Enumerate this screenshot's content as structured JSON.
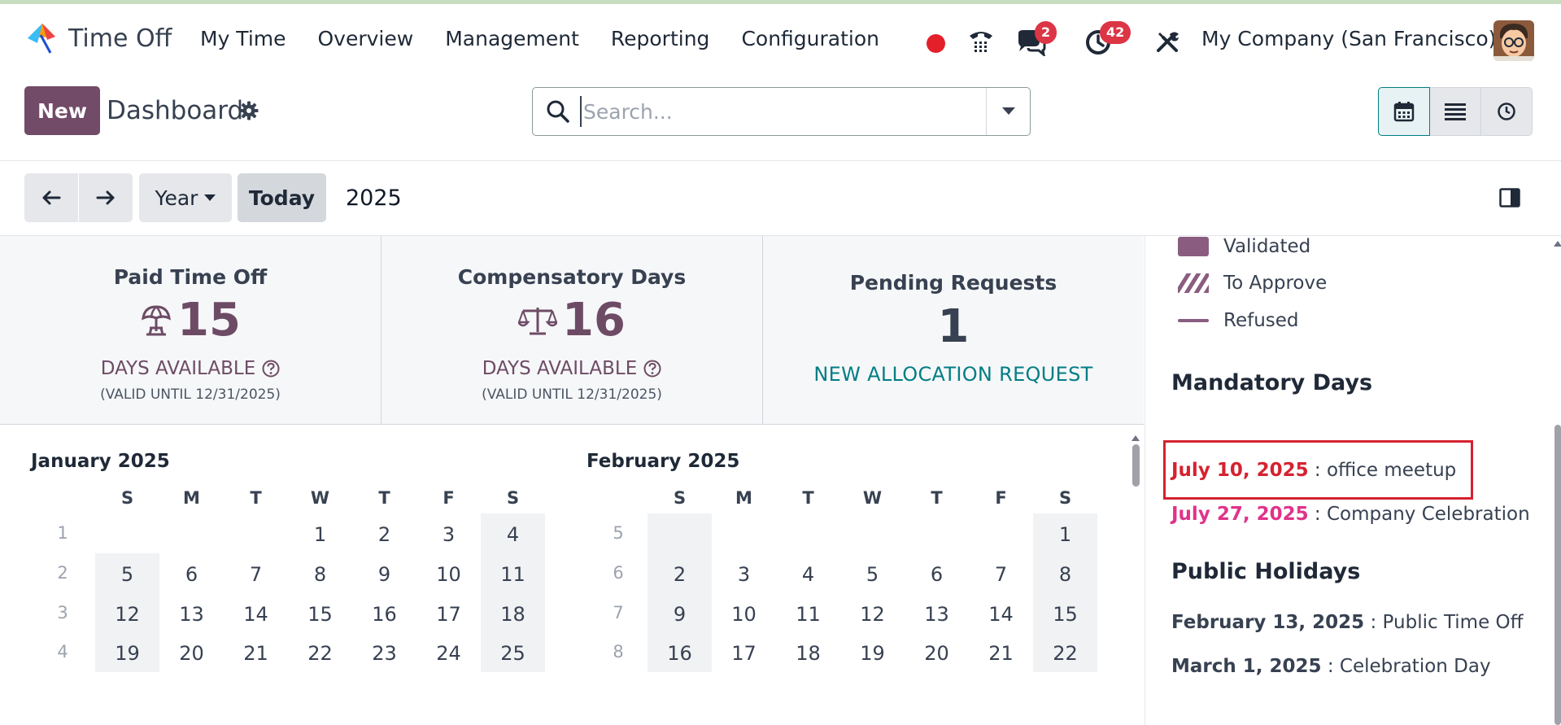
{
  "app": {
    "name": "Time Off"
  },
  "menu": [
    "My Time",
    "Overview",
    "Management",
    "Reporting",
    "Configuration"
  ],
  "systray": {
    "messages_badge": "2",
    "activities_badge": "42",
    "company": "My Company (San Francisco)"
  },
  "control_panel": {
    "new_label": "New",
    "title": "Dashboard",
    "search_placeholder": "Search..."
  },
  "toolbar": {
    "scale_label": "Year",
    "today_label": "Today",
    "current_period": "2025"
  },
  "stats": {
    "paid": {
      "title": "Paid Time Off",
      "value": "15",
      "sub": "DAYS AVAILABLE",
      "valid": "(VALID UNTIL 12/31/2025)"
    },
    "comp": {
      "title": "Compensatory Days",
      "value": "16",
      "sub": "DAYS AVAILABLE",
      "valid": "(VALID UNTIL 12/31/2025)"
    },
    "pending": {
      "title": "Pending Requests",
      "value": "1",
      "link": "NEW ALLOCATION REQUEST"
    }
  },
  "calendar": {
    "dow": [
      "S",
      "M",
      "T",
      "W",
      "T",
      "F",
      "S"
    ],
    "months": [
      {
        "title": "January 2025",
        "weeks": [
          {
            "wk": "1",
            "days": [
              "",
              "",
              "",
              "1",
              "2",
              "3",
              "4"
            ]
          },
          {
            "wk": "2",
            "days": [
              "5",
              "6",
              "7",
              "8",
              "9",
              "10",
              "11"
            ]
          },
          {
            "wk": "3",
            "days": [
              "12",
              "13",
              "14",
              "15",
              "16",
              "17",
              "18"
            ]
          },
          {
            "wk": "4",
            "days": [
              "19",
              "20",
              "21",
              "22",
              "23",
              "24",
              "25"
            ]
          }
        ]
      },
      {
        "title": "February 2025",
        "weeks": [
          {
            "wk": "5",
            "days": [
              "",
              "",
              "",
              "",
              "",
              "",
              "1"
            ]
          },
          {
            "wk": "6",
            "days": [
              "2",
              "3",
              "4",
              "5",
              "6",
              "7",
              "8"
            ]
          },
          {
            "wk": "7",
            "days": [
              "9",
              "10",
              "11",
              "12",
              "13",
              "14",
              "15"
            ]
          },
          {
            "wk": "8",
            "days": [
              "16",
              "17",
              "18",
              "19",
              "20",
              "21",
              "22"
            ]
          }
        ]
      }
    ]
  },
  "sidebar": {
    "legend": [
      {
        "label": "Validated",
        "color": "#8a5d80"
      },
      {
        "label": "To Approve",
        "color": "#8a5d80"
      },
      {
        "label": "Refused",
        "color": "#8a5d80"
      }
    ],
    "mandatory_title": "Mandatory Days",
    "mandatory": [
      {
        "date": "July 10, 2025",
        "name": " : office meetup",
        "color": "#d62230"
      },
      {
        "date": "July 27, 2025",
        "name": " : Company Celebration",
        "color": "#e0338a"
      }
    ],
    "holidays_title": "Public Holidays",
    "holidays": [
      {
        "date": "February 13, 2025",
        "name": " : Public Time Off"
      },
      {
        "date": "March 1, 2025",
        "name": " : Celebration Day"
      }
    ]
  }
}
